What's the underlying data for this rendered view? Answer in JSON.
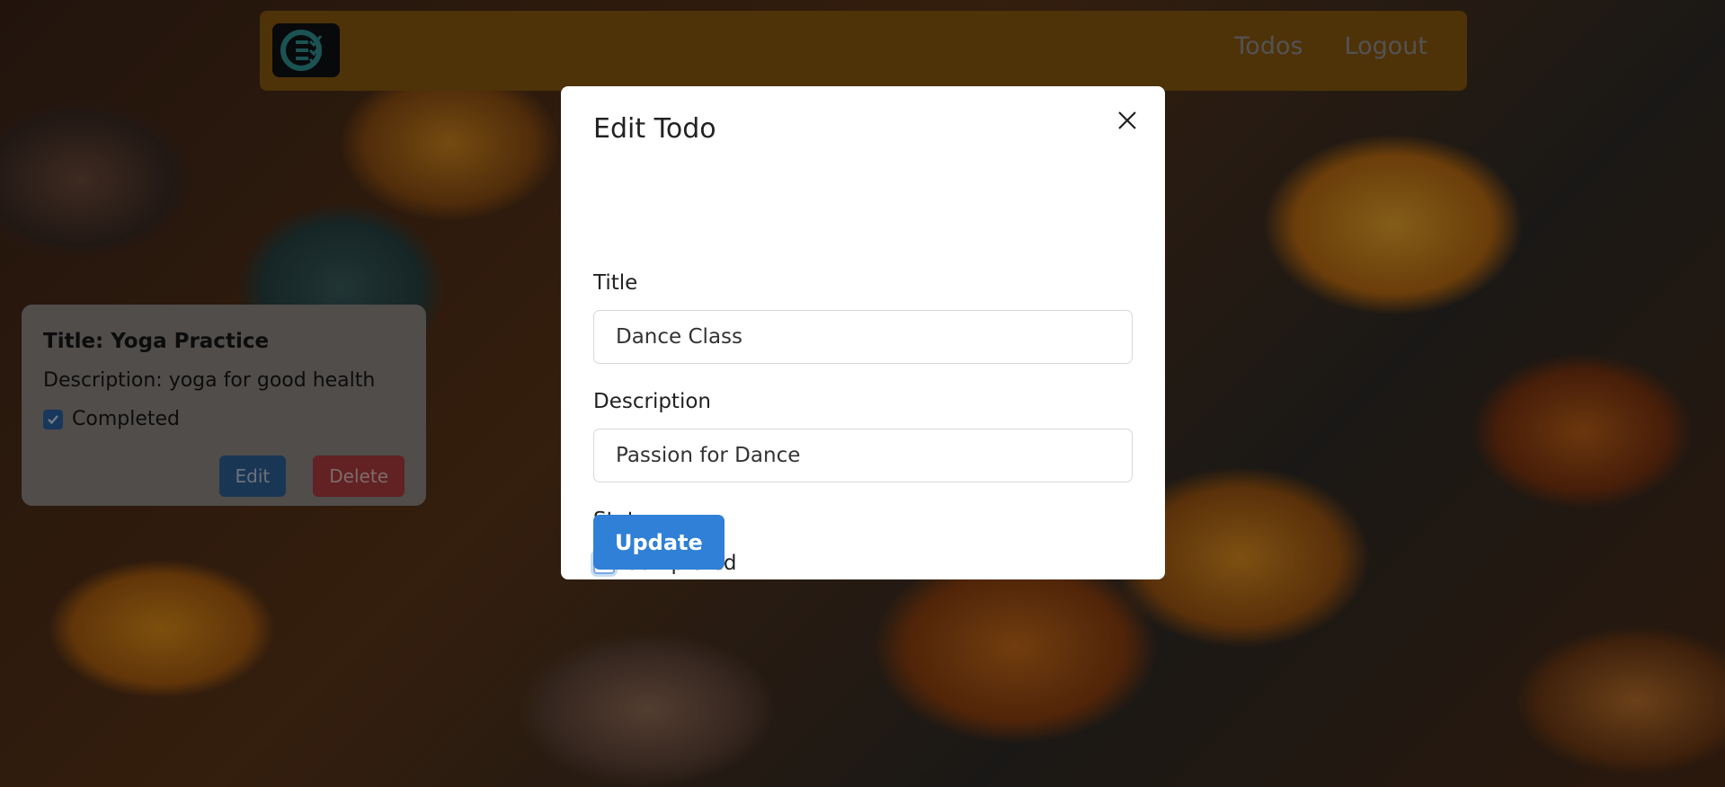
{
  "nav": {
    "links": [
      {
        "label": "Todos"
      },
      {
        "label": "Logout"
      }
    ]
  },
  "todo_card": {
    "title": "Title: Yoga Practice",
    "description": "Description: yoga for good health",
    "status_label": "Completed",
    "completed": true,
    "edit_label": "Edit",
    "delete_label": "Delete"
  },
  "modal": {
    "title": "Edit Todo",
    "title_label": "Title",
    "title_value": "Dance Class",
    "description_label": "Description",
    "description_value": "Passion for Dance",
    "status_label": "Status",
    "completed_label": "Completed",
    "completed": false,
    "update_label": "Update"
  }
}
